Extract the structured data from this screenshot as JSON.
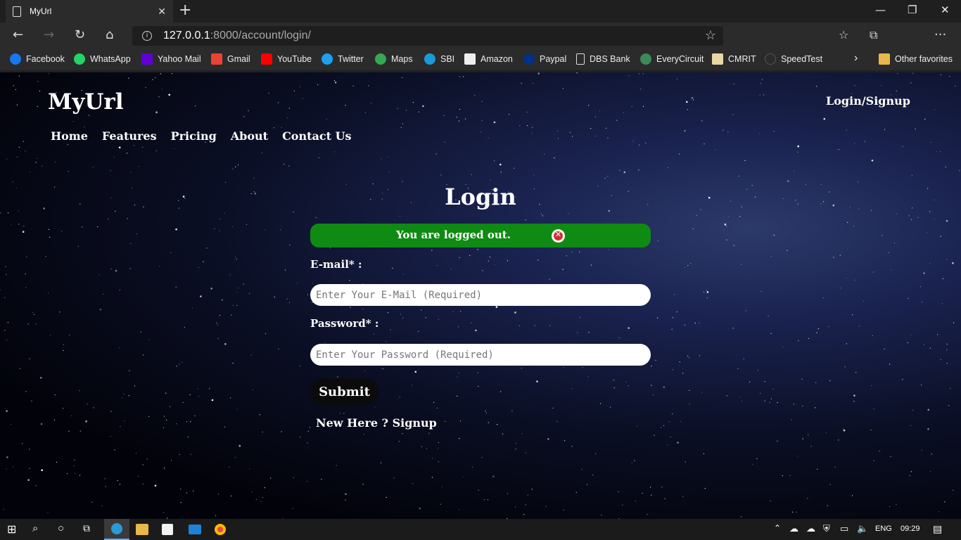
{
  "browser": {
    "tab_title": "MyUrl",
    "tab_close": "✕",
    "new_tab": "+",
    "url_host": "127.0.0.1",
    "url_rest": ":8000/account/login/",
    "bookmarks": [
      "Facebook",
      "WhatsApp",
      "Yahoo Mail",
      "Gmail",
      "YouTube",
      "Twitter",
      "Maps",
      "SBI",
      "Amazon",
      "Paypal",
      "DBS Bank",
      "EveryCircuit",
      "CMRIT",
      "SpeedTest"
    ],
    "other_favorites": "Other favorites",
    "icons": [
      "back-icon",
      "forward-icon",
      "refresh-icon",
      "home-icon",
      "info-icon",
      "star-icon",
      "settings-more-icon"
    ]
  },
  "site": {
    "brand": "MyUrl",
    "login_signup": "Login/Signup",
    "nav": [
      "Home",
      "Features",
      "Pricing",
      "About",
      "Contact Us"
    ],
    "page_title": "Login",
    "alert_message": "You are logged out.",
    "alert_close": "✕",
    "email_label": "E-mail* :",
    "email_placeholder": "Enter Your E-Mail (Required)",
    "password_label": "Password* :",
    "password_placeholder": "Enter Your Password (Required)",
    "submit_label": "Submit",
    "signup_link": "New Here ? Signup"
  },
  "taskbar": {
    "language": "ENG",
    "time": "09:29"
  },
  "colors": {
    "alert_green": "#0f8a12",
    "submit_bg": "#0b0b0b",
    "browser_chrome": "#2b2b2b"
  }
}
